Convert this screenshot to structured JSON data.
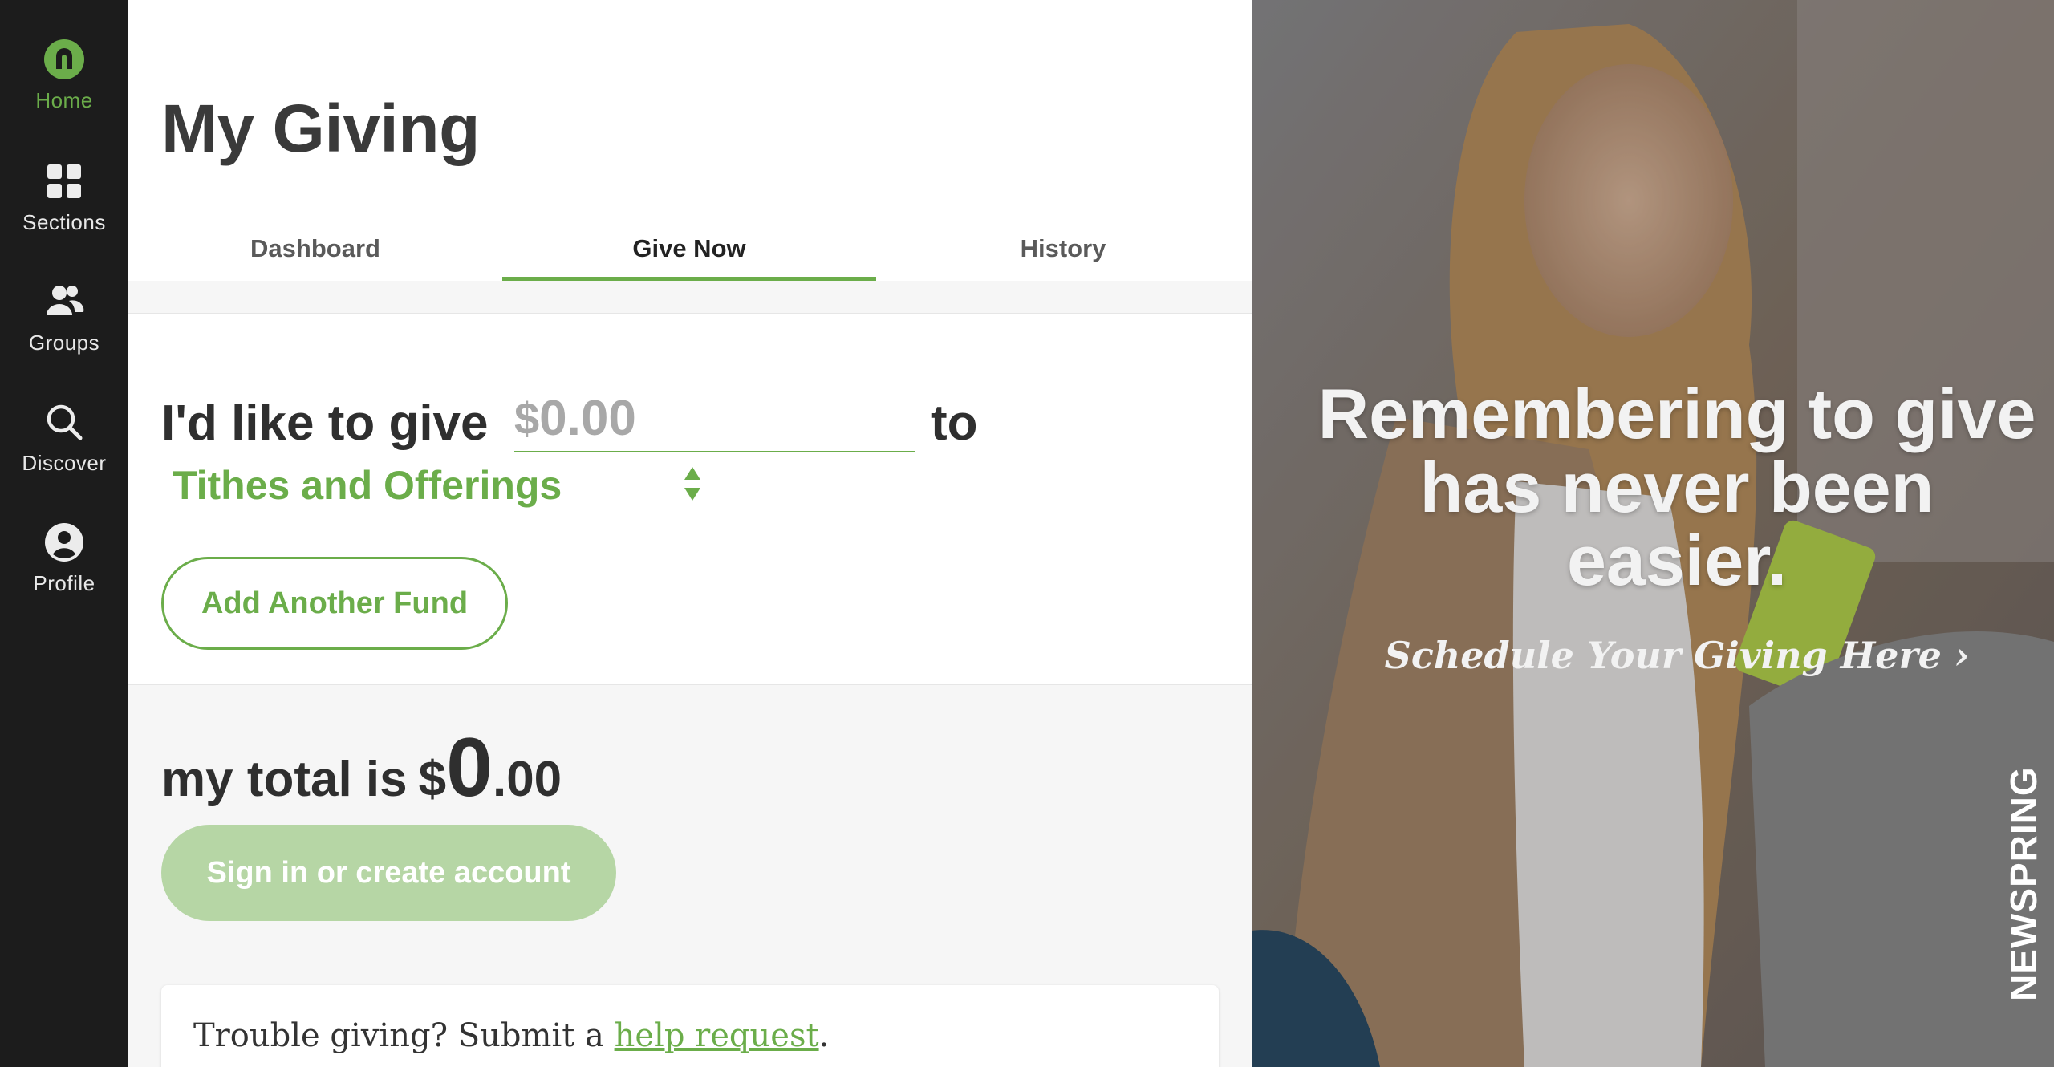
{
  "sidebar": {
    "items": [
      {
        "label": "Home",
        "icon": "home-logo-icon",
        "active": true
      },
      {
        "label": "Sections",
        "icon": "grid-icon"
      },
      {
        "label": "Groups",
        "icon": "people-icon"
      },
      {
        "label": "Discover",
        "icon": "search-icon"
      },
      {
        "label": "Profile",
        "icon": "user-circle-icon"
      }
    ]
  },
  "main": {
    "title": "My Giving",
    "tabs": [
      {
        "label": "Dashboard"
      },
      {
        "label": "Give Now",
        "active": true
      },
      {
        "label": "History"
      }
    ],
    "give": {
      "prefix": "I'd like to give",
      "currency_symbol": "$",
      "amount_placeholder": "0.00",
      "connector": "to",
      "fund_selected": "Tithes and Offerings",
      "add_fund_label": "Add Another Fund"
    },
    "total": {
      "label": "my total is",
      "currency": "$",
      "major": "0",
      "minor": ".00"
    },
    "signin_label": "Sign in or create account",
    "help": {
      "prefix": "Trouble giving? Submit a ",
      "link": "help request",
      "suffix": "."
    }
  },
  "promo": {
    "headline": "Remembering to give has never been easier.",
    "link_label": "Schedule Your Giving Here",
    "brand": "NEWSPRING"
  },
  "colors": {
    "accent": "#6bad4a",
    "accent_light": "#b6d6a5",
    "sidebar_bg": "#1c1c1c",
    "text_dark": "#2f2f2f"
  }
}
